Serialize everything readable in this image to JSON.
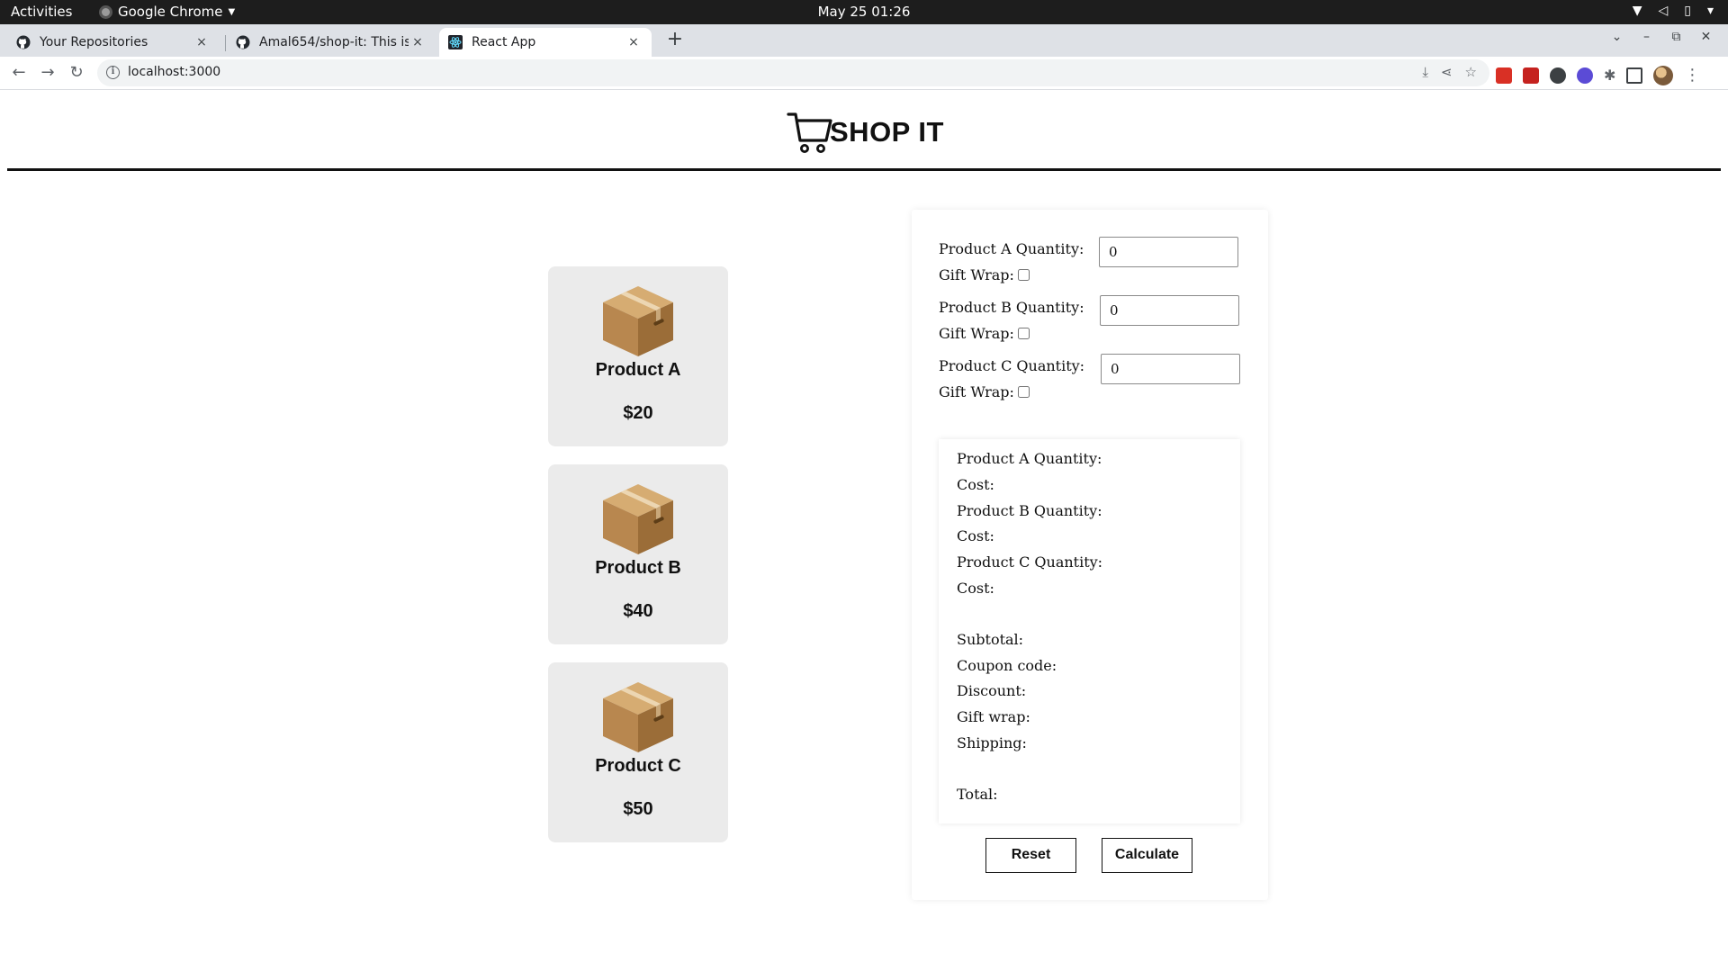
{
  "system_bar": {
    "activities": "Activities",
    "app_name": "Google Chrome",
    "clock": "May 25  01:26"
  },
  "browser": {
    "tabs": [
      {
        "title": "Your Repositories",
        "close": "×"
      },
      {
        "title": "Amal654/shop-it: This is a",
        "close": "×"
      },
      {
        "title": "React App",
        "close": "×"
      }
    ],
    "new_tab": "+",
    "url": "localhost:3000"
  },
  "app": {
    "brand": "SHOP IT",
    "products": [
      {
        "name": "Product A",
        "price": "$20"
      },
      {
        "name": "Product B",
        "price": "$40"
      },
      {
        "name": "Product C",
        "price": "$50"
      }
    ],
    "form": {
      "rows": [
        {
          "label": "Product A Quantity:",
          "value": "0",
          "gift_wrap_label": "Gift Wrap:",
          "gift_wrap_checked": false
        },
        {
          "label": "Product B Quantity:",
          "value": "0",
          "gift_wrap_label": "Gift Wrap:",
          "gift_wrap_checked": false
        },
        {
          "label": "Product C Quantity:",
          "value": "0",
          "gift_wrap_label": "Gift Wrap:",
          "gift_wrap_checked": false
        }
      ]
    },
    "summary": {
      "a_quantity": "Product A Quantity:",
      "a_cost": "Cost:",
      "b_quantity": "Product B Quantity:",
      "b_cost": "Cost:",
      "c_quantity": "Product C Quantity:",
      "c_cost": "Cost:",
      "subtotal": "Subtotal:",
      "coupon_code": "Coupon code:",
      "discount": "Discount:",
      "gift_wrap": "Gift wrap:",
      "shipping": "Shipping:",
      "total": "Total:"
    },
    "buttons": {
      "reset": "Reset",
      "calculate": "Calculate"
    }
  }
}
